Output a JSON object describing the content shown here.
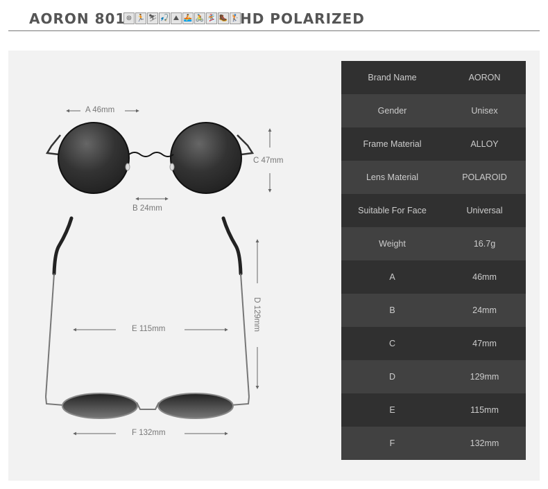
{
  "header": {
    "model": "AORON 801",
    "tagline": "HD POLARIZED",
    "sport_icons": [
      "steering-wheel",
      "running",
      "skiing",
      "fishing",
      "climbing",
      "boating",
      "cycling",
      "snowboarding",
      "hiking",
      "golf"
    ],
    "sport_glyphs": [
      "⊛",
      "🏃",
      "⛷",
      "🎣",
      "⛰",
      "🚣",
      "🚴",
      "🏂",
      "🥾",
      "🏌"
    ]
  },
  "dimensions": {
    "A": "A 46mm",
    "B": "B 24mm",
    "C": "C 47mm",
    "D": "D 129mm",
    "E": "E 115mm",
    "F": "F 132mm"
  },
  "specs": [
    {
      "key": "Brand Name",
      "value": "AORON"
    },
    {
      "key": "Gender",
      "value": "Unisex"
    },
    {
      "key": "Frame Material",
      "value": "ALLOY"
    },
    {
      "key": "Lens Material",
      "value": "POLAROID"
    },
    {
      "key": "Suitable For Face",
      "value": "Universal"
    },
    {
      "key": "Weight",
      "value": "16.7g"
    },
    {
      "key": "A",
      "value": "46mm"
    },
    {
      "key": "B",
      "value": "24mm"
    },
    {
      "key": "C",
      "value": "47mm"
    },
    {
      "key": "D",
      "value": "129mm"
    },
    {
      "key": "E",
      "value": "115mm"
    },
    {
      "key": "F",
      "value": "132mm"
    }
  ],
  "colors": {
    "row_dark": "#303030",
    "row_light": "#414141",
    "text": "#cccccc",
    "panel": "#f2f2f2"
  }
}
